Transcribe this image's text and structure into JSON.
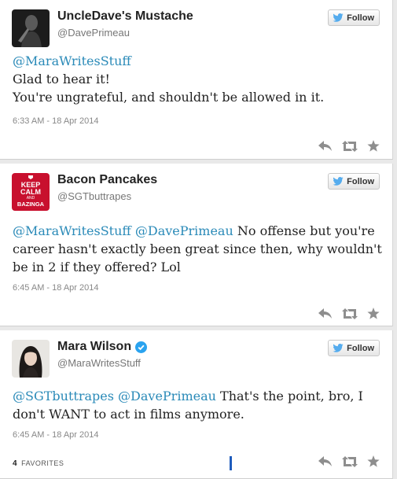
{
  "tweets": [
    {
      "name": "UncleDave's Mustache",
      "handle": "@DavePrimeau",
      "follow_label": "Follow",
      "mentions": [
        "@MaraWritesStuff"
      ],
      "line1": "Glad to hear it!",
      "line2": "You're ungrateful, and shouldn't be allowed in it.",
      "time": "6:33 AM - 18 Apr 2014"
    },
    {
      "name": "Bacon Pancakes",
      "handle": "@SGTbuttrapes",
      "follow_label": "Follow",
      "avatar_text": [
        "KEEP",
        "CALM",
        "AND",
        "BAZINGA"
      ],
      "mentions": [
        "@MaraWritesStuff",
        "@DavePrimeau"
      ],
      "line1": "No offense but you're",
      "line2": "career hasn't exactly been great since then, why wouldn't",
      "line3": "be in 2 if they offered? Lol",
      "time": "6:45 AM - 18 Apr 2014"
    },
    {
      "name": "Mara Wilson",
      "verified": true,
      "handle": "@MaraWritesStuff",
      "follow_label": "Follow",
      "mentions": [
        "@SGTbuttrapes",
        "@DavePrimeau"
      ],
      "line1": "That's the point, bro, I",
      "line2": "don't WANT to act in films anymore.",
      "time": "6:45 AM - 18 Apr 2014",
      "favorites_count": "4",
      "favorites_label": "FAVORITES"
    }
  ],
  "icons": [
    "reply-icon",
    "retweet-icon",
    "favorite-icon",
    "twitter-bird-icon",
    "verified-badge-icon"
  ],
  "colors": {
    "mention": "#2a8ab8",
    "bird": "#55acee",
    "verified": "#2aa3ef",
    "icon": "#8e8e8e"
  }
}
